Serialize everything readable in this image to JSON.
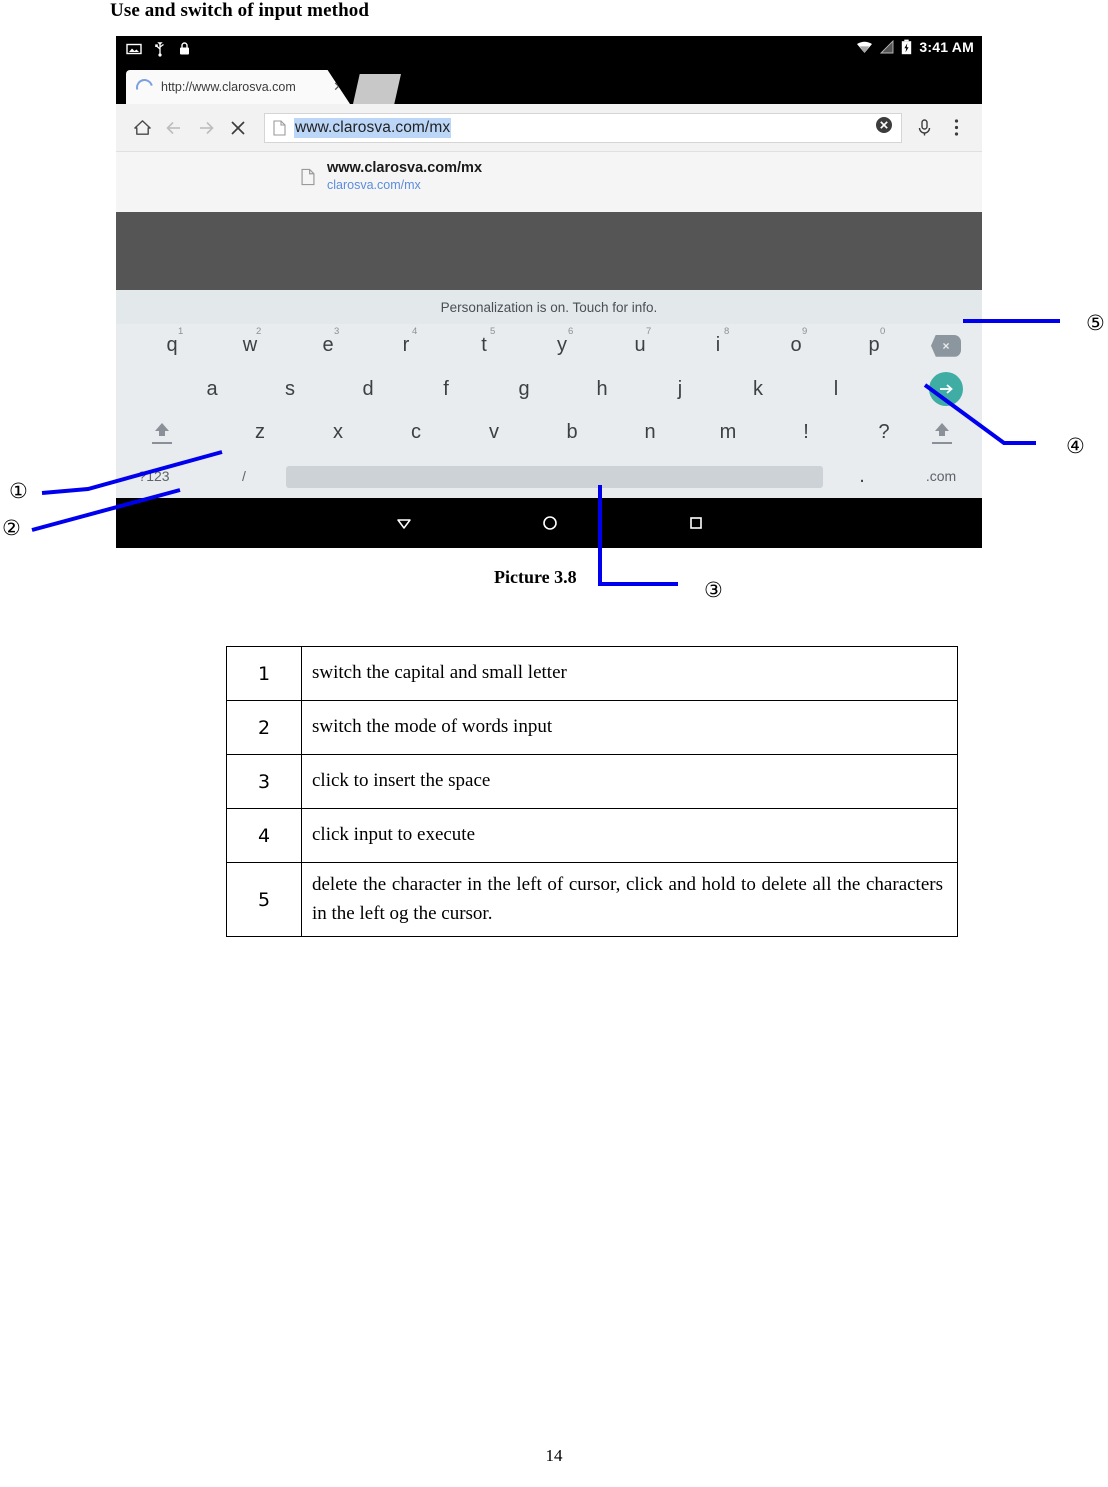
{
  "document": {
    "heading": "Use and switch of input method",
    "caption": "Picture 3.8",
    "page_number": "14"
  },
  "device": {
    "statusbar": {
      "time": "3:41 AM",
      "left_icons": [
        "screenshot-icon",
        "usb-icon",
        "lock-icon"
      ],
      "right_icons": [
        "wifi-icon",
        "signal-icon",
        "battery-icon"
      ]
    },
    "tab": {
      "title": "http://www.clarosva.com",
      "close_label": "✕"
    },
    "toolbar": {
      "home_icon": "home-icon",
      "back_icon": "back-arrow-icon",
      "forward_icon": "forward-arrow-icon",
      "stop_icon": "stop-x-icon",
      "url_value": "www.clarosva.com/mx",
      "url_doc_icon": "document-icon",
      "clear_icon": "clear-circle-icon",
      "mic_icon": "microphone-icon",
      "menu_icon": "overflow-menu-icon"
    },
    "suggestion": {
      "icon": "document-icon",
      "title": "www.clarosva.com/mx",
      "subtitle": "clarosva.com/mx"
    },
    "keyboard": {
      "notice": "Personalization is on. Touch for info.",
      "row1": [
        {
          "key": "q",
          "num": "1"
        },
        {
          "key": "w",
          "num": "2"
        },
        {
          "key": "e",
          "num": "3"
        },
        {
          "key": "r",
          "num": "4"
        },
        {
          "key": "t",
          "num": "5"
        },
        {
          "key": "y",
          "num": "6"
        },
        {
          "key": "u",
          "num": "7"
        },
        {
          "key": "i",
          "num": "8"
        },
        {
          "key": "o",
          "num": "9"
        },
        {
          "key": "p",
          "num": "0"
        }
      ],
      "row2": [
        "a",
        "s",
        "d",
        "f",
        "g",
        "h",
        "j",
        "k",
        "l"
      ],
      "row3": [
        "z",
        "x",
        "c",
        "v",
        "b",
        "n",
        "m",
        "!",
        "?"
      ],
      "symbols_key": "?123",
      "slash_key": "/",
      "period_key": ".",
      "dotcom_key": ".com",
      "backspace_glyph": "×",
      "enter_icon": "enter-arrow-icon",
      "shift_icon": "shift-arrow-icon",
      "space_key_label": ""
    },
    "navbar": {
      "back_icon": "nav-back-triangle-icon",
      "home_icon": "nav-home-circle-icon",
      "recents_icon": "nav-recents-square-icon"
    }
  },
  "annotations": {
    "markers": [
      "①",
      "②",
      "③",
      "④",
      "⑤"
    ],
    "line_color": "#0000ee"
  },
  "legend": {
    "rows": [
      {
        "num": "1",
        "desc": "switch the capital and small letter"
      },
      {
        "num": "2",
        "desc": "switch the mode of words input"
      },
      {
        "num": "3",
        "desc": "click to insert the space"
      },
      {
        "num": "4",
        "desc": "click input to execute"
      },
      {
        "num": "5",
        "desc": "delete the character in the left of cursor, click and hold to delete all the characters in the left og the cursor."
      }
    ]
  },
  "colors": {
    "enter_key_teal": "#3fada3",
    "url_selection_blue": "#bcd6f7",
    "annotation_blue": "#0000ee",
    "page_dark_gray": "#555555",
    "keyboard_bg": "#e8ecef"
  }
}
